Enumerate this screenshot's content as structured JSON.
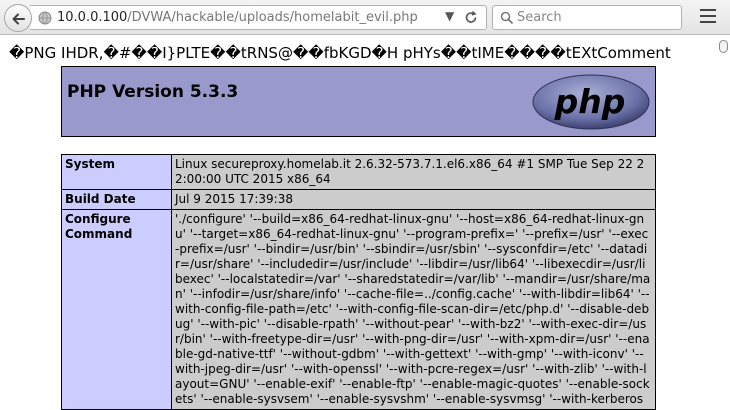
{
  "browser": {
    "url_host": "10.0.0.100",
    "url_path": "/DVWA/hackable/uploads/homelabit_evil.php",
    "search_placeholder": "Search"
  },
  "page": {
    "garbage_header": "�PNG  IHDR,�#��I}PLTE��tRNS@��fbKGD�H pHYs��tIME����tEXtComment",
    "php_version": "PHP Version 5.3.3",
    "logo_text": "php",
    "rows": [
      {
        "key": "System",
        "value": "Linux secureproxy.homelab.it 2.6.32-573.7.1.el6.x86_64 #1 SMP Tue Sep 22 22:00:00 UTC 2015 x86_64"
      },
      {
        "key": "Build Date",
        "value": "Jul 9 2015 17:39:38"
      },
      {
        "key": "Configure Command",
        "value": "'./configure' '--build=x86_64-redhat-linux-gnu' '--host=x86_64-redhat-linux-gnu' '--target=x86_64-redhat-linux-gnu' '--program-prefix=' '--prefix=/usr' '--exec-prefix=/usr' '--bindir=/usr/bin' '--sbindir=/usr/sbin' '--sysconfdir=/etc' '--datadir=/usr/share' '--includedir=/usr/include' '--libdir=/usr/lib64' '--libexecdir=/usr/libexec' '--localstatedir=/var' '--sharedstatedir=/var/lib' '--mandir=/usr/share/man' '--infodir=/usr/share/info' '--cache-file=../config.cache' '--with-libdir=lib64' '--with-config-file-path=/etc' '--with-config-file-scan-dir=/etc/php.d' '--disable-debug' '--with-pic' '--disable-rpath' '--without-pear' '--with-bz2' '--with-exec-dir=/usr/bin' '--with-freetype-dir=/usr' '--with-png-dir=/usr' '--with-xpm-dir=/usr' '--enable-gd-native-ttf' '--without-gdbm' '--with-gettext' '--with-gmp' '--with-iconv' '--with-jpeg-dir=/usr' '--with-openssl' '--with-pcre-regex=/usr' '--with-zlib' '--with-layout=GNU' '--enable-exif' '--enable-ftp' '--enable-magic-quotes' '--enable-sockets' '--enable-sysvsem' '--enable-sysvshm' '--enable-sysvmsg' '--with-kerberos"
      }
    ]
  },
  "colors": {
    "header_bg": "#9999cc",
    "key_bg": "#ccccff",
    "value_bg": "#cccccc"
  },
  "icons": [
    "back-arrow-icon",
    "globe-icon",
    "dropdown-icon",
    "reload-icon",
    "search-icon",
    "menu-icon"
  ]
}
